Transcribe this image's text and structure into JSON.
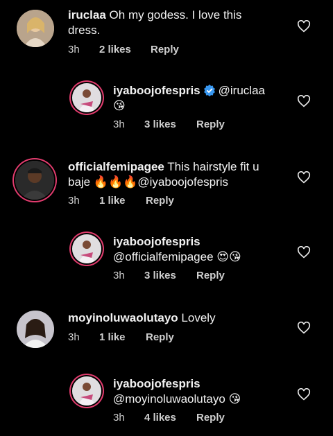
{
  "comments": [
    {
      "username": "iruclaa",
      "text": "Oh my godess.  I love this dress.",
      "line1": "Oh my godess.  I love this",
      "line2": "dress.",
      "time": "3h",
      "likes": "2 likes",
      "reply": "Reply"
    },
    {
      "username": "iyaboojofespris",
      "mention": "@iruclaa",
      "emoji": "😘",
      "time": "3h",
      "likes": "3 likes",
      "reply": "Reply"
    },
    {
      "username": "officialfemipagee",
      "line1": "This hairstyle fit u",
      "line2_pre": "baje",
      "fires": "🔥🔥🔥",
      "line2_mention": "@iyaboojofespris",
      "time": "3h",
      "likes": "1 like",
      "reply": "Reply"
    },
    {
      "username": "iyaboojofespris",
      "mention": "@officialfemipagee",
      "emoji": "😍😘",
      "time": "3h",
      "likes": "3 likes",
      "reply": "Reply"
    },
    {
      "username": "moyinoluwaolutayo",
      "text": "Lovely",
      "time": "3h",
      "likes": "1 like",
      "reply": "Reply"
    },
    {
      "username": "iyaboojofespris",
      "mention": "@moyinoluwaolutayo",
      "emoji": "😘",
      "time": "3h",
      "likes": "4 likes",
      "reply": "Reply"
    }
  ],
  "colors": {
    "background": "#000000",
    "verified": "#3897f0",
    "story_ring": "#e23c6e"
  }
}
